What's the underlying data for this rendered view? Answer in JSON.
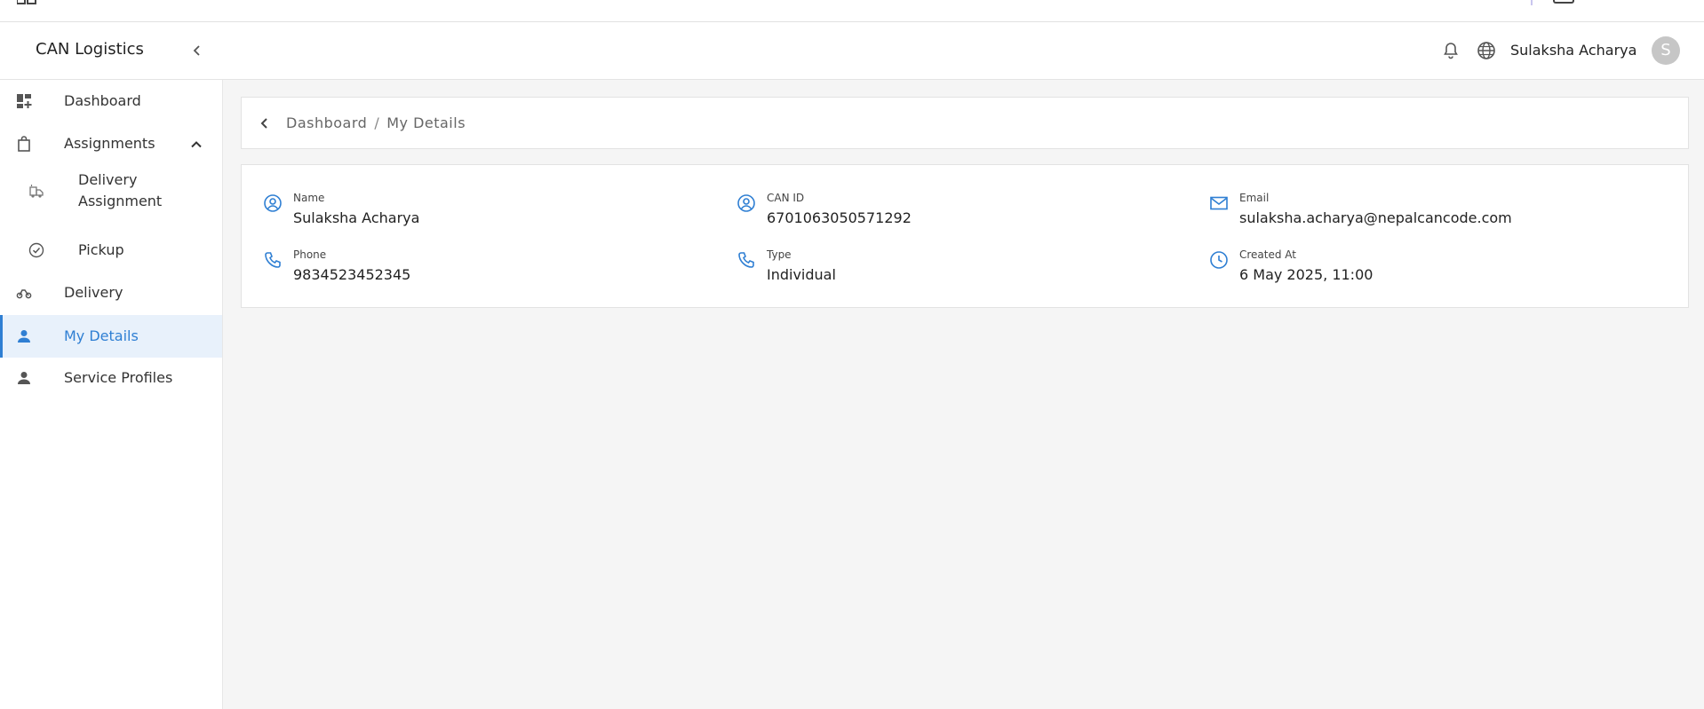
{
  "app": {
    "brand": "CAN Logistics",
    "user_name": "Sulaksha Acharya",
    "avatar_initial": "S",
    "accent_color": "#2f7fd3"
  },
  "sidebar": {
    "items": [
      {
        "label": "Dashboard",
        "icon": "dashboard-icon"
      },
      {
        "label": "Assignments",
        "icon": "bag-icon",
        "expanded": true
      },
      {
        "label": "Delivery Assignment",
        "icon": "delivery-truck-icon",
        "sub": true
      },
      {
        "label": "Pickup",
        "icon": "check-circle-icon",
        "sub": true
      },
      {
        "label": "Delivery",
        "icon": "scooter-icon"
      },
      {
        "label": "My Details",
        "icon": "person-icon",
        "active": true
      },
      {
        "label": "Service Profiles",
        "icon": "person-icon"
      }
    ]
  },
  "breadcrumb": {
    "root": "Dashboard",
    "separator": "/",
    "current": "My Details"
  },
  "details": {
    "name": {
      "label": "Name",
      "value": "Sulaksha Acharya"
    },
    "can_id": {
      "label": "CAN ID",
      "value": "6701063050571292"
    },
    "email": {
      "label": "Email",
      "value": "sulaksha.acharya@nepalcancode.com"
    },
    "phone": {
      "label": "Phone",
      "value": "9834523452345"
    },
    "type": {
      "label": "Type",
      "value": "Individual"
    },
    "created_at": {
      "label": "Created At",
      "value": "6 May 2025, 11:00"
    }
  }
}
